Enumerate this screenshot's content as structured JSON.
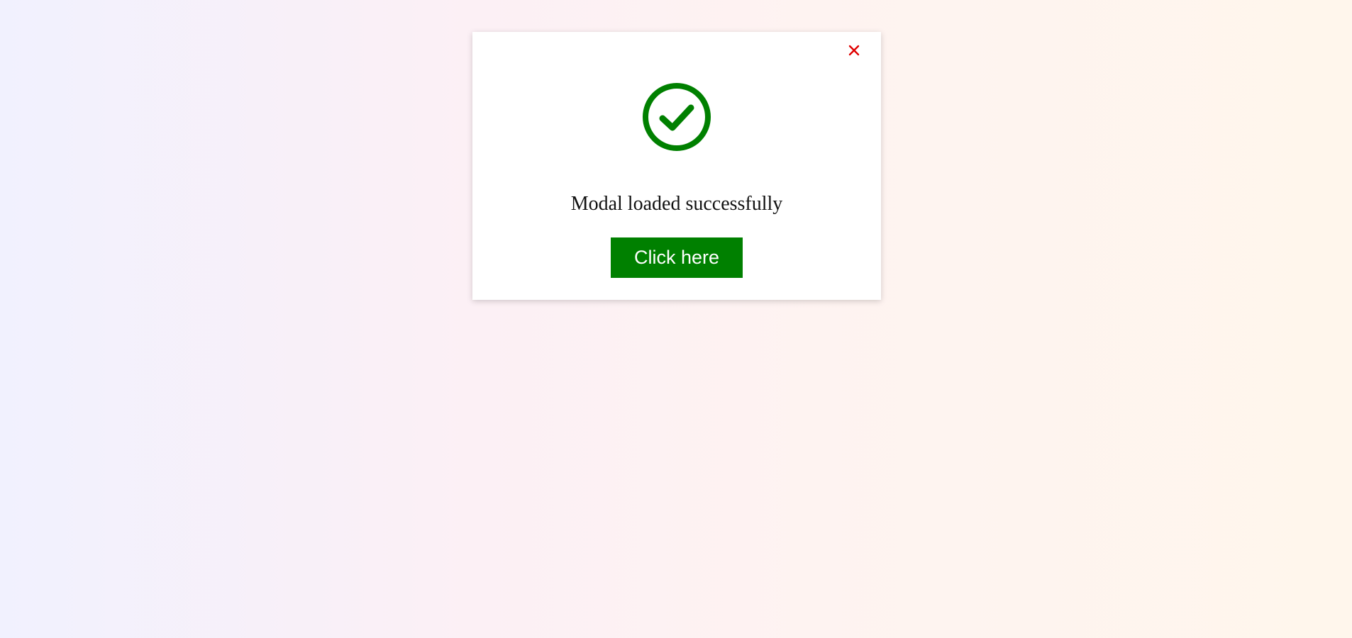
{
  "modal": {
    "message": "Modal loaded successfully",
    "button_label": "Click here",
    "close_icon": "close-icon",
    "status_icon": "check-circle-icon"
  },
  "colors": {
    "accent": "#008000",
    "close": "#e00000",
    "background_start": "#f1f1fe",
    "background_end": "#fff6ec"
  }
}
